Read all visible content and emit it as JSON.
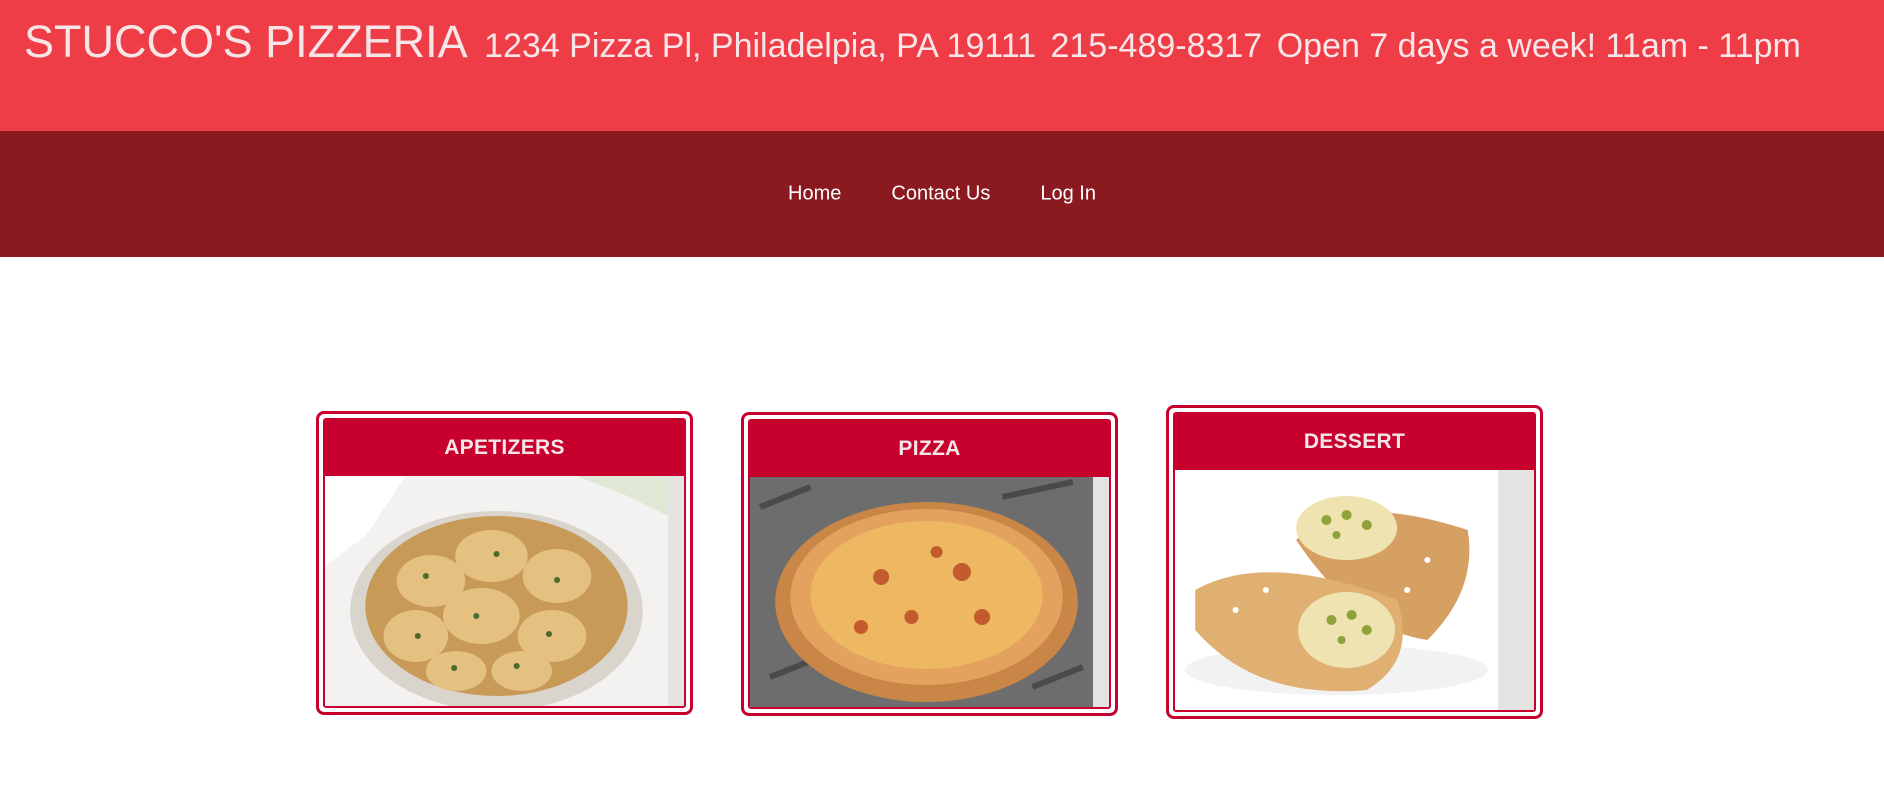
{
  "header": {
    "brand": "STUCCO'S PIZZERIA",
    "address": "1234 Pizza Pl, Philadelpia, PA 19111",
    "phone": "215-489-8317",
    "hours": "Open 7 days a week! 11am - 11pm",
    "bg_color": "#ef3d48"
  },
  "nav": {
    "bg_color": "#8a1a1f",
    "items": [
      {
        "label": "Home"
      },
      {
        "label": "Contact Us"
      },
      {
        "label": "Log In"
      }
    ]
  },
  "menu_cards": [
    {
      "title": "APETIZERS",
      "image": "garlic-knots-photo"
    },
    {
      "title": "PIZZA",
      "image": "cheese-pizza-photo"
    },
    {
      "title": "DESSERT",
      "image": "cannoli-photo"
    }
  ],
  "accent_color": "#c8002e"
}
